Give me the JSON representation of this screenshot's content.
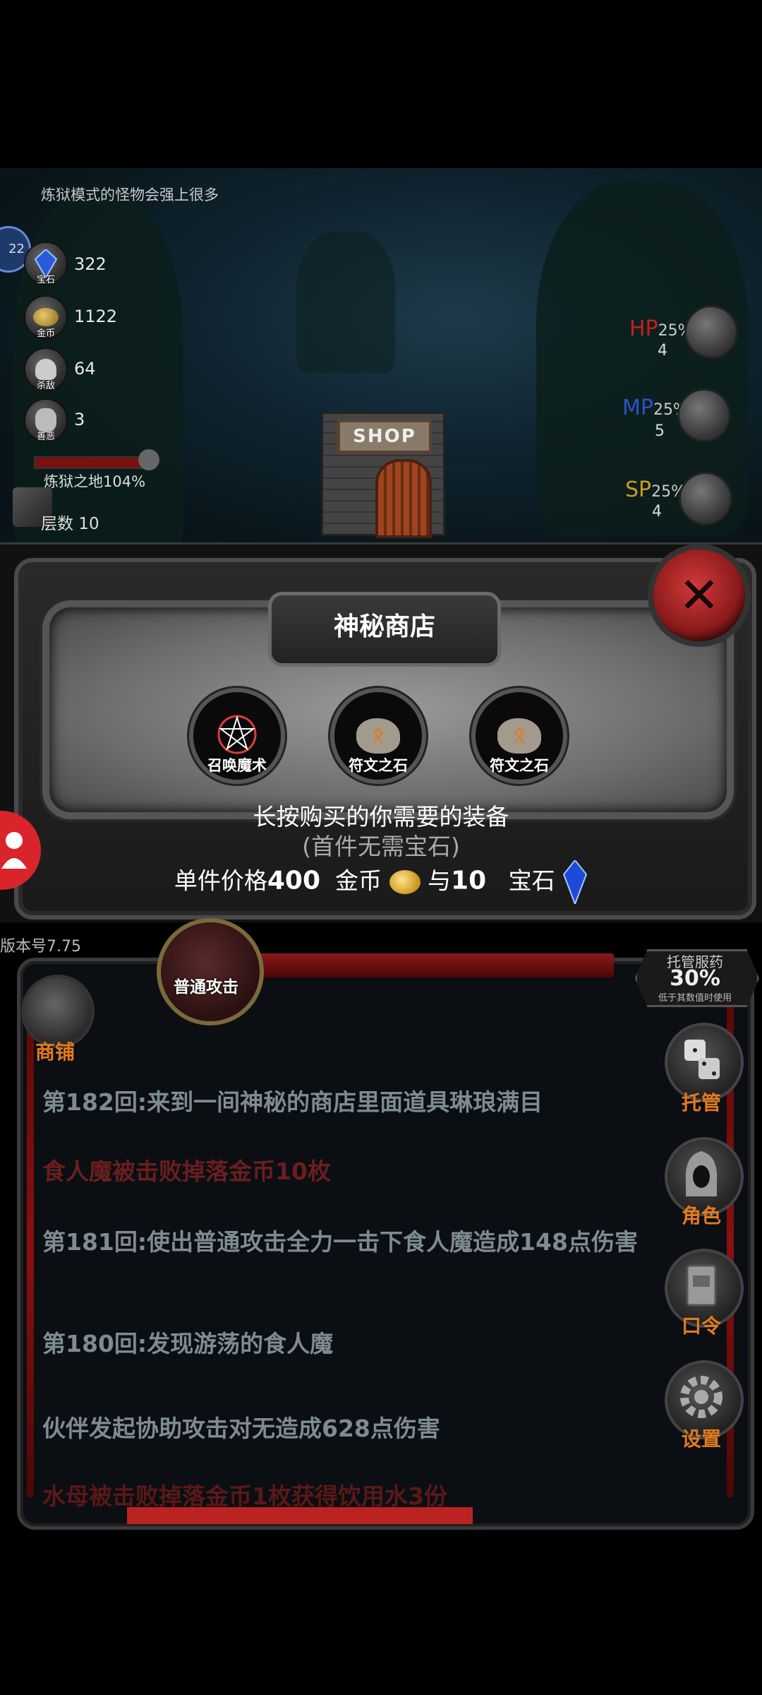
{
  "header": {
    "hint": "炼狱模式的怪物会强上很多"
  },
  "resources": [
    {
      "name": "gem",
      "label": "宝石",
      "value": "322"
    },
    {
      "name": "coin",
      "label": "金币",
      "value": "1122"
    },
    {
      "name": "skull",
      "label": "杀敌",
      "value": "64"
    },
    {
      "name": "mask",
      "label": "善恶",
      "value": "3"
    }
  ],
  "level_badge": "22",
  "area": {
    "name": "炼狱之地104%",
    "floor_label": "层数 10"
  },
  "potions": [
    {
      "type": "HP",
      "percent": "25%",
      "count": "4",
      "color": "#c81e1e"
    },
    {
      "type": "MP",
      "percent": "25%",
      "count": "5",
      "color": "#2a52c8"
    },
    {
      "type": "SP",
      "percent": "25%",
      "count": "4",
      "color": "#c89a1e"
    }
  ],
  "shop_sign": "SHOP",
  "modal": {
    "title": "神秘商店",
    "items": [
      {
        "label": "召唤魔术"
      },
      {
        "label": "符文之石"
      },
      {
        "label": "符文之石"
      }
    ],
    "instruction": "长按购买的你需要的装备",
    "instruction_note": "(首件无需宝石)",
    "price_prefix": "单件价格",
    "price_coins": "400",
    "coin_word": "金币",
    "and_word": "与",
    "price_gems": "10",
    "gem_word": "宝石"
  },
  "version": "版本号7.75",
  "attack_button": "普通攻击",
  "shop_button": "商铺",
  "auto_med": {
    "title": "托管服药",
    "value": "30%",
    "sub": "低于其数值时使用"
  },
  "side_buttons": [
    {
      "label": "托管",
      "icon": "dice-icon"
    },
    {
      "label": "角色",
      "icon": "hooded-figure-icon"
    },
    {
      "label": "口令",
      "icon": "book-icon"
    },
    {
      "label": "设置",
      "icon": "gear-icon"
    }
  ],
  "log": [
    {
      "text": "第182回:来到一间神秘的商店里面道具琳琅满目",
      "color": "#7e8b92"
    },
    {
      "text": "食人魔被击败掉落金币10枚",
      "color": "#6a1e1e"
    },
    {
      "text": "第181回:使出普通攻击全力一击下食人魔造成148点伤害",
      "color": "#7e8b92"
    },
    {
      "text": "第180回:发现游荡的食人魔",
      "color": "#7e8b92"
    },
    {
      "text": "伙伴发起协助攻击对无造成628点伤害",
      "color": "#7e8b92"
    },
    {
      "text": "水母被击败掉落金币1枚获得饮用水3份",
      "color": "#5a1818"
    }
  ]
}
